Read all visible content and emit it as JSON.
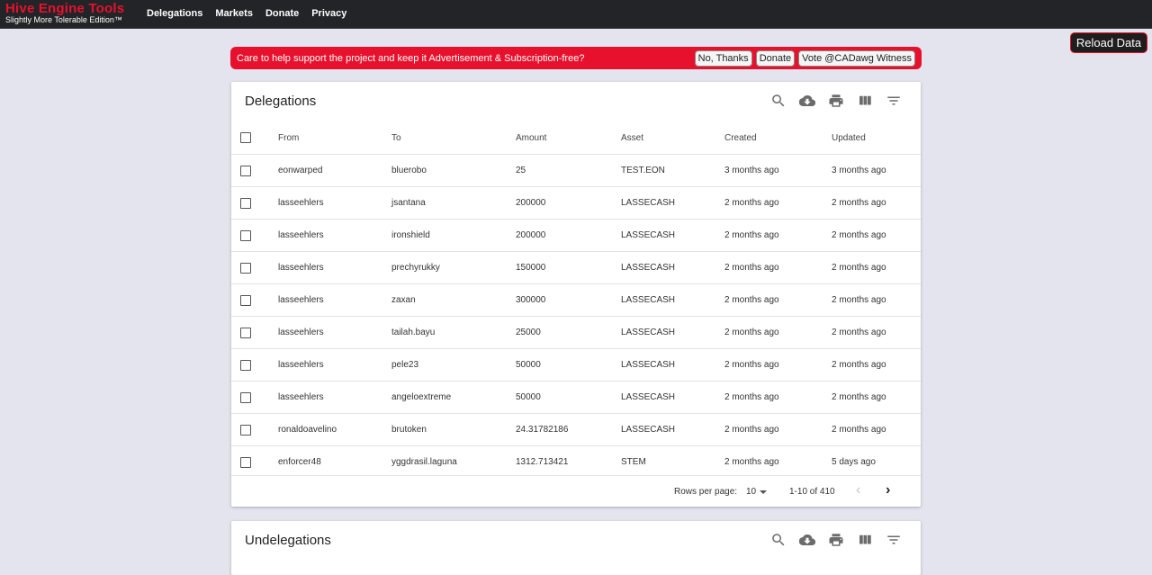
{
  "nav": {
    "brand_title": "Hive Engine Tools",
    "brand_subtitle": "Slightly More Tolerable Edition™",
    "links": [
      "Delegations",
      "Markets",
      "Donate",
      "Privacy"
    ]
  },
  "reload_label": "Reload Data",
  "banner": {
    "text": "Care to help support the project and keep it Advertisement & Subscription-free?",
    "buttons": [
      "No, Thanks",
      "Donate",
      "Vote @CADawg Witness"
    ]
  },
  "toolbar_icons": [
    "search-icon",
    "cloud-download-icon",
    "print-icon",
    "view-column-icon",
    "filter-icon"
  ],
  "delegations": {
    "title": "Delegations",
    "columns": [
      "From",
      "To",
      "Amount",
      "Asset",
      "Created",
      "Updated"
    ],
    "rows": [
      [
        "eonwarped",
        "bluerobo",
        "25",
        "TEST.EON",
        "3 months ago",
        "3 months ago"
      ],
      [
        "lasseehlers",
        "jsantana",
        "200000",
        "LASSECASH",
        "2 months ago",
        "2 months ago"
      ],
      [
        "lasseehlers",
        "ironshield",
        "200000",
        "LASSECASH",
        "2 months ago",
        "2 months ago"
      ],
      [
        "lasseehlers",
        "prechyrukky",
        "150000",
        "LASSECASH",
        "2 months ago",
        "2 months ago"
      ],
      [
        "lasseehlers",
        "zaxan",
        "300000",
        "LASSECASH",
        "2 months ago",
        "2 months ago"
      ],
      [
        "lasseehlers",
        "tailah.bayu",
        "25000",
        "LASSECASH",
        "2 months ago",
        "2 months ago"
      ],
      [
        "lasseehlers",
        "pele23",
        "50000",
        "LASSECASH",
        "2 months ago",
        "2 months ago"
      ],
      [
        "lasseehlers",
        "angeloextreme",
        "50000",
        "LASSECASH",
        "2 months ago",
        "2 months ago"
      ],
      [
        "ronaldoavelino",
        "brutoken",
        "24.31782186",
        "LASSECASH",
        "2 months ago",
        "2 months ago"
      ],
      [
        "enforcer48",
        "yggdrasil.laguna",
        "1312.713421",
        "STEM",
        "2 months ago",
        "5 days ago"
      ]
    ],
    "rows_per_page_label": "Rows per page:",
    "rows_per_page": "10",
    "page_range": "1-10 of 410"
  },
  "undelegations": {
    "title": "Undelegations"
  }
}
